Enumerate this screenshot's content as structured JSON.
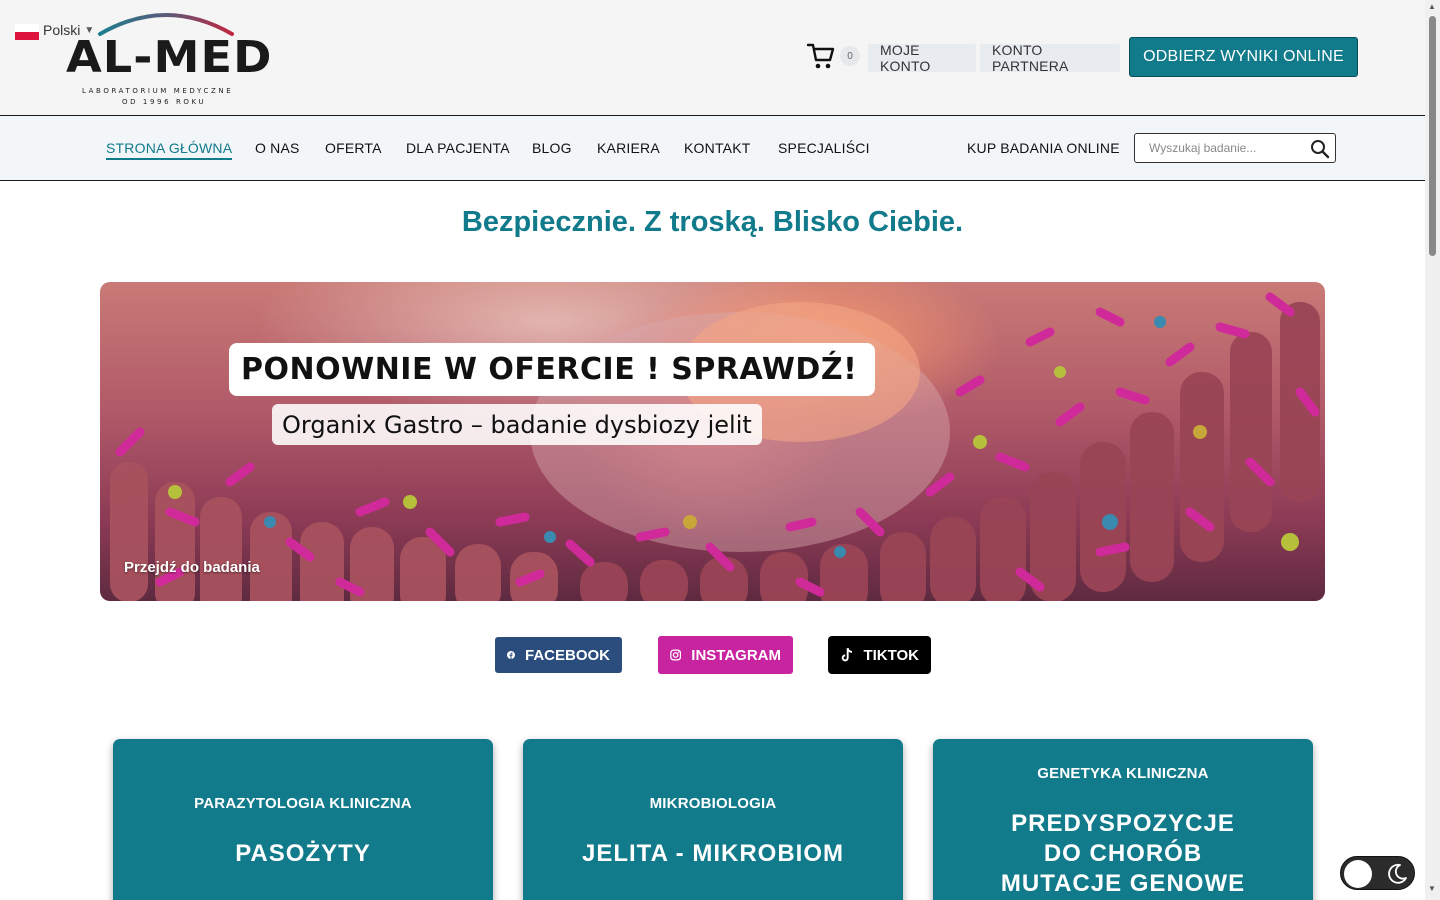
{
  "header": {
    "language": "Polski",
    "logo": {
      "wordmark": "AL-MED",
      "subtitle_line1": "LABORATORIUM MEDYCZNE",
      "subtitle_line2": "OD 1996 ROKU"
    },
    "cart_count": "0",
    "account_label": "MOJE KONTO",
    "partner_label": "KONTO PARTNERA",
    "results_button": "ODBIERZ WYNIKI ONLINE"
  },
  "nav": {
    "items": [
      {
        "label": "STRONA GŁÓWNA",
        "active": true
      },
      {
        "label": "O NAS"
      },
      {
        "label": "OFERTA"
      },
      {
        "label": "DLA PACJENTA"
      },
      {
        "label": "BLOG"
      },
      {
        "label": "KARIERA"
      },
      {
        "label": "KONTAKT"
      },
      {
        "label": "SPECJALIŚCI"
      }
    ],
    "buy_online": "KUP BADANIA ONLINE",
    "search_placeholder": "Wyszukaj badanie..."
  },
  "main": {
    "tagline": "Bezpiecznie. Z troską. Blisko Ciebie.",
    "hero": {
      "title": "PONOWNIE W OFERCIE ! SPRAWDŹ!",
      "subtitle": "Organix Gastro – badanie dysbiozy jelit",
      "link": "Przejdź do badania"
    },
    "social": {
      "facebook": "FACEBOOK",
      "instagram": "INSTAGRAM",
      "tiktok": "TIKTOK"
    },
    "cards": [
      {
        "category": "PARAZYTOLOGIA KLINICZNA",
        "title": "PASOŻYTY"
      },
      {
        "category": "MIKROBIOLOGIA",
        "title": "JELITA - MIKROBIOM"
      },
      {
        "category": "GENETYKA KLINICZNA",
        "title_lines": [
          "PREDYSPOZYCJE",
          "DO CHORÓB",
          "MUTACJE GENOWE"
        ]
      }
    ]
  },
  "colors": {
    "brand_teal": "#117a8b",
    "facebook": "#2a4d7d",
    "instagram": "#c8249f",
    "tiktok": "#000000",
    "logo_arc_start": "#1e7f8e",
    "logo_arc_end": "#c0273f"
  },
  "icons": {
    "cart": "cart-icon",
    "search": "search-icon",
    "facebook": "facebook-icon",
    "instagram": "instagram-icon",
    "tiktok": "tiktok-icon",
    "theme": "moon-icon"
  }
}
